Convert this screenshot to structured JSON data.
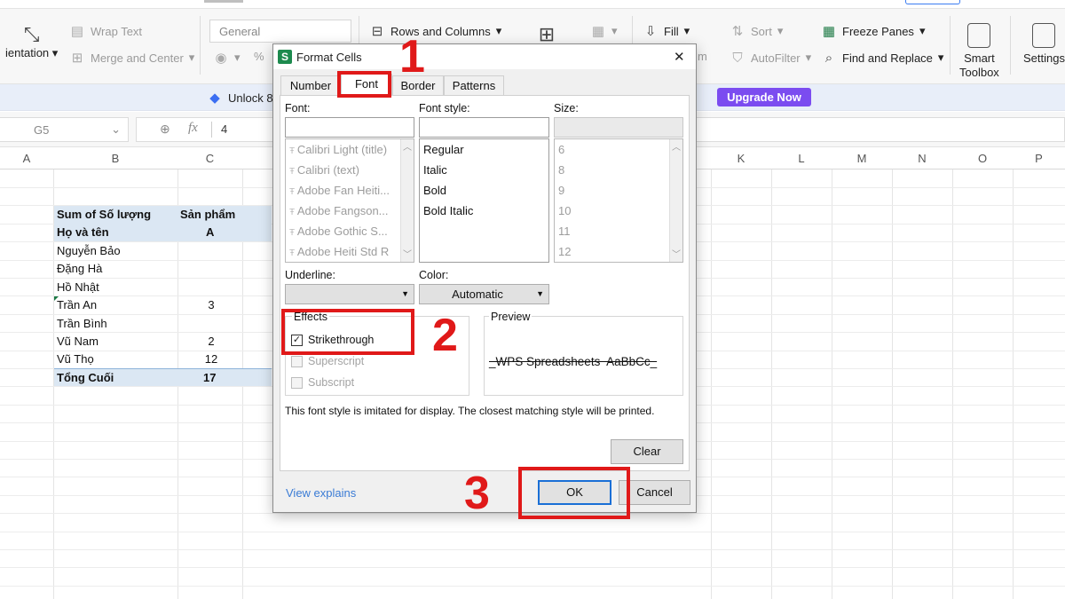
{
  "ribbon": {
    "orientation": "ientation",
    "wrap_text": "Wrap Text",
    "merge_center": "Merge and Center",
    "number_format": "General",
    "percent": "%",
    "rows_columns": "Rows and Columns",
    "fill": "Fill",
    "sort": "Sort",
    "autofilter": "AutoFilter",
    "freeze_panes": "Freeze Panes",
    "find_replace": "Find and Replace",
    "smart_toolbox_1": "Smart",
    "smart_toolbox_2": "Toolbox",
    "settings": "Settings",
    "partial_m": "m"
  },
  "banner": {
    "unlock_text": "Unlock 8",
    "upgrade_label": "Upgrade Now"
  },
  "formula_bar": {
    "cell_ref": "G5",
    "value": "4"
  },
  "sheet": {
    "columns_left": [
      "A",
      "B",
      "C"
    ],
    "columns_right": [
      "K",
      "L",
      "M",
      "N",
      "O",
      "P"
    ],
    "pivot": {
      "header1_b": "Sum of Số lượng",
      "header1_c": "Sản phẩm",
      "header2_b": "Họ và tên",
      "header2_c": "A",
      "rows": [
        {
          "name": "Nguyễn Bảo",
          "value": ""
        },
        {
          "name": "Đặng Hà",
          "value": ""
        },
        {
          "name": "Hồ Nhật",
          "value": ""
        },
        {
          "name": "Trần An",
          "value": "3"
        },
        {
          "name": "Trần Bình",
          "value": ""
        },
        {
          "name": "Vũ Nam",
          "value": "2"
        },
        {
          "name": "Vũ Thọ",
          "value": "12"
        }
      ],
      "total_label": "Tổng Cuối",
      "total_value": "17"
    }
  },
  "dialog": {
    "title": "Format Cells",
    "tabs": [
      "Number",
      "Font",
      "Border",
      "Patterns"
    ],
    "active_tab": "Font",
    "font_label": "Font:",
    "font_style_label": "Font style:",
    "size_label": "Size:",
    "fonts": [
      "Calibri Light (title)",
      "Calibri (text)",
      "Adobe Fan Heiti...",
      "Adobe Fangson...",
      "Adobe Gothic S...",
      "Adobe Heiti Std R"
    ],
    "styles": [
      "Regular",
      "Italic",
      "Bold",
      "Bold Italic"
    ],
    "sizes": [
      "6",
      "8",
      "9",
      "10",
      "11",
      "12"
    ],
    "underline_label": "Underline:",
    "color_label": "Color:",
    "color_value": "Automatic",
    "effects_label": "Effects",
    "strikethrough_label": "Strikethrough",
    "strikethrough_checked": true,
    "superscript_label": "Superscript",
    "subscript_label": "Subscript",
    "preview_label": "Preview",
    "preview_text": "_WPS Spreadsheets  AaBbCc_",
    "note": "This font style is imitated for display. The closest matching style will be printed.",
    "clear_label": "Clear",
    "view_explains": "View explains",
    "ok_label": "OK",
    "cancel_label": "Cancel",
    "close_symbol": "✕"
  },
  "annotations": {
    "step1": "1",
    "step2": "2",
    "step3": "3",
    "color": "#e01919"
  }
}
